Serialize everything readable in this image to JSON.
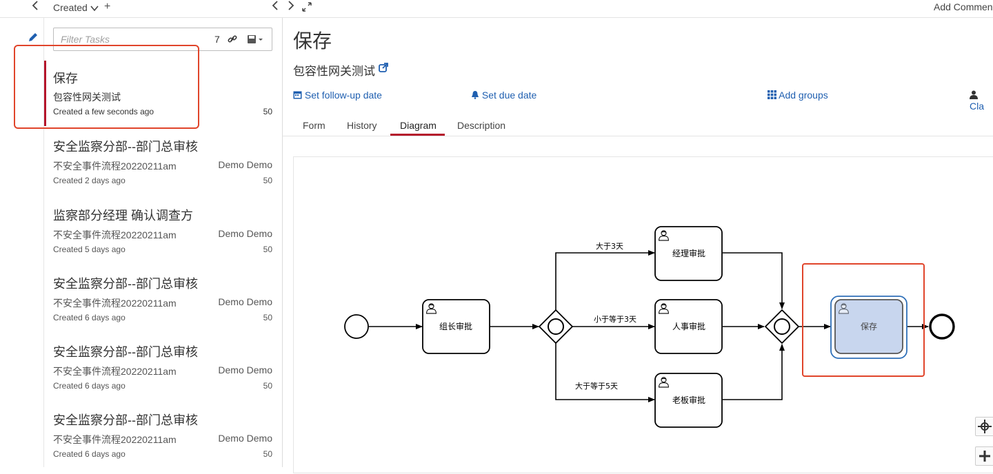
{
  "nav": {
    "collapse_icon": "chevron-left-icon",
    "edit_icon": "pencil-icon"
  },
  "list": {
    "sort_label": "Created",
    "add_icon": "plus-icon",
    "filter": {
      "placeholder": "Filter Tasks",
      "count": "7"
    },
    "tasks": [
      {
        "title": "保存",
        "process": "包容性网关测试",
        "assignee": "",
        "created": "Created a few seconds ago",
        "priority": "50"
      },
      {
        "title": "安全监察分部--部门总审核",
        "process": "不安全事件流程20220211am",
        "assignee": "Demo Demo",
        "created": "Created 2 days ago",
        "priority": "50"
      },
      {
        "title": "监察部分经理 确认调查方",
        "process": "不安全事件流程20220211am",
        "assignee": "Demo Demo",
        "created": "Created 5 days ago",
        "priority": "50"
      },
      {
        "title": "安全监察分部--部门总审核",
        "process": "不安全事件流程20220211am",
        "assignee": "Demo Demo",
        "created": "Created 6 days ago",
        "priority": "50"
      },
      {
        "title": "安全监察分部--部门总审核",
        "process": "不安全事件流程20220211am",
        "assignee": "Demo Demo",
        "created": "Created 6 days ago",
        "priority": "50"
      },
      {
        "title": "安全监察分部--部门总审核",
        "process": "不安全事件流程20220211am",
        "assignee": "Demo Demo",
        "created": "Created 6 days ago",
        "priority": "50"
      }
    ]
  },
  "main": {
    "add_comment": "Add Comment",
    "task_title": "保存",
    "process_name": "包容性网关测试",
    "actions": {
      "follow_up": "Set follow-up date",
      "due": "Set due date",
      "groups": "Add groups",
      "claim": "Cla"
    },
    "tabs": [
      "Form",
      "History",
      "Diagram",
      "Description"
    ],
    "active_tab": "Diagram",
    "diagram": {
      "tasks": {
        "leader": "组长审批",
        "manager": "经理审批",
        "hr": "人事审批",
        "boss": "老板审批",
        "save": "保存"
      },
      "flows": {
        "gt3": "大于3天",
        "le3": "小于等于3天",
        "ge5": "大于等于5天"
      }
    }
  },
  "colors": {
    "accent_red": "#b5152b",
    "link_blue": "#1f5fb0",
    "highlight_box": "#e0442a",
    "active_task_fill": "#c8d6ee"
  }
}
